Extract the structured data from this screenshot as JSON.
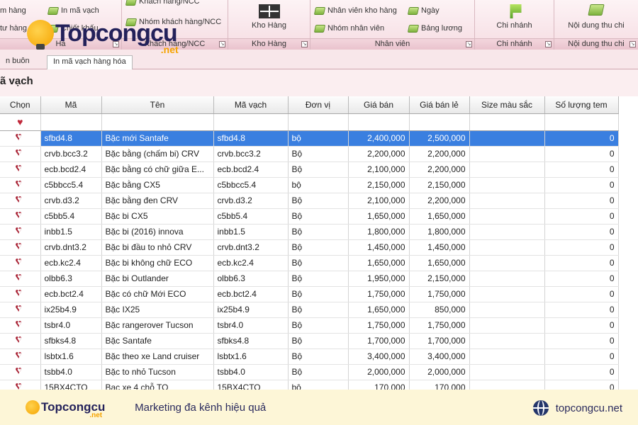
{
  "ribbon": {
    "g1": {
      "item1": "m hàng",
      "item2": "In mã vạch",
      "item3": "tư hàng",
      "item4": "Chiết khấu",
      "title": "Hà"
    },
    "g2": {
      "item1": "Khách hàng/NCC",
      "item2": "Nhóm khách hàng/NCC",
      "title": "Khách hàng/NCC"
    },
    "g3": {
      "btn": "Kho Hàng",
      "title": "Kho Hàng"
    },
    "g4": {
      "item1": "Nhân viên kho hàng",
      "item2": "Ngày",
      "item3": "Nhóm nhân viên",
      "item4": "Bảng lương",
      "title": "Nhân viên"
    },
    "g5": {
      "btn": "Chi nhánh",
      "title": "Chi nhánh"
    },
    "g6": {
      "btn": "Nội dung thu chi",
      "title": "Nội dung thu chi"
    }
  },
  "tabs": {
    "tab1": "n buôn",
    "tab2": "In mã vạch hàng hóa"
  },
  "page_title": "ã vạch",
  "table": {
    "headers": [
      "Chọn",
      "Mã",
      "Tên",
      "Mã vạch",
      "Đơn vị",
      "Giá bán",
      "Giá bán lẻ",
      "Size màu sắc",
      "Số lượng tem"
    ],
    "rows": [
      [
        "sfbd4.8",
        "Bặc mới Santafe",
        "sfbd4.8",
        "bộ",
        "2,400,000",
        "2,500,000",
        "",
        "0"
      ],
      [
        "crvb.bcc3.2",
        "Bặc bằng (chấm bi) CRV",
        "crvb.bcc3.2",
        "Bộ",
        "2,200,000",
        "2,200,000",
        "",
        "0"
      ],
      [
        "ecb.bcd2.4",
        "Bặc bằng có chữ giữa E...",
        "ecb.bcd2.4",
        "Bộ",
        "2,100,000",
        "2,200,000",
        "",
        "0"
      ],
      [
        "c5bbcc5.4",
        "Bặc bằng CX5",
        "c5bbcc5.4",
        "bộ",
        "2,150,000",
        "2,150,000",
        "",
        "0"
      ],
      [
        "crvb.d3.2",
        "Bặc bằng đen CRV",
        "crvb.d3.2",
        "Bộ",
        "2,100,000",
        "2,200,000",
        "",
        "0"
      ],
      [
        "c5bb5.4",
        "Bặc bi  CX5",
        "c5bb5.4",
        "Bộ",
        "1,650,000",
        "1,650,000",
        "",
        "0"
      ],
      [
        "inbb1.5",
        "Bặc bi (2016) innova",
        "inbb1.5",
        "Bộ",
        "1,800,000",
        "1,800,000",
        "",
        "0"
      ],
      [
        "crvb.dnt3.2",
        "Bặc bi đầu to nhỏ CRV",
        "crvb.dnt3.2",
        "Bộ",
        "1,450,000",
        "1,450,000",
        "",
        "0"
      ],
      [
        "ecb.kc2.4",
        "Bặc bi không chữ  ECO",
        "ecb.kc2.4",
        "Bộ",
        "1,650,000",
        "1,650,000",
        "",
        "0"
      ],
      [
        "olbb6.3",
        "Bặc bi Outlander",
        "olbb6.3",
        "Bộ",
        "1,950,000",
        "2,150,000",
        "",
        "0"
      ],
      [
        "ecb.bct2.4",
        "Bặc có chữ Mới ECO",
        "ecb.bct2.4",
        "Bộ",
        "1,750,000",
        "1,750,000",
        "",
        "0"
      ],
      [
        "ix25b4.9",
        "Bặc IX25",
        "ix25b4.9",
        "Bộ",
        "1,650,000",
        "850,000",
        "",
        "0"
      ],
      [
        "tsbr4.0",
        "Bặc rangerover Tucson",
        "tsbr4.0",
        "Bộ",
        "1,750,000",
        "1,750,000",
        "",
        "0"
      ],
      [
        "sfbks4.8",
        "Bặc Santafe",
        "sfbks4.8",
        "Bộ",
        "1,700,000",
        "1,700,000",
        "",
        "0"
      ],
      [
        "lsbtx1.6",
        "Bặc theo xe Land cruiser",
        "lsbtx1.6",
        "Bộ",
        "3,400,000",
        "3,400,000",
        "",
        "0"
      ],
      [
        "tsbb4.0",
        "Bặc to nhỏ Tucson",
        "tsbb4.0",
        "Bộ",
        "2,000,000",
        "2,000,000",
        "",
        "0"
      ],
      [
        "15BX4CTO",
        "Bạc xe 4 chỗ TO",
        "15BX4CTO",
        "bộ",
        "170,000",
        "170,000",
        "",
        "0"
      ]
    ]
  },
  "watermark": {
    "brand": "Topcongcu",
    "net": ".net"
  },
  "footer": {
    "brand": "Topcongcu",
    "net": ".net",
    "slogan": "Marketing đa kênh hiệu quả",
    "site": "topcongcu.net"
  },
  "colors": {
    "accent": "#3a7fe0",
    "heart": "#c0283a",
    "ribbon": "#f6dde3",
    "banner": "#fdf6d7"
  }
}
